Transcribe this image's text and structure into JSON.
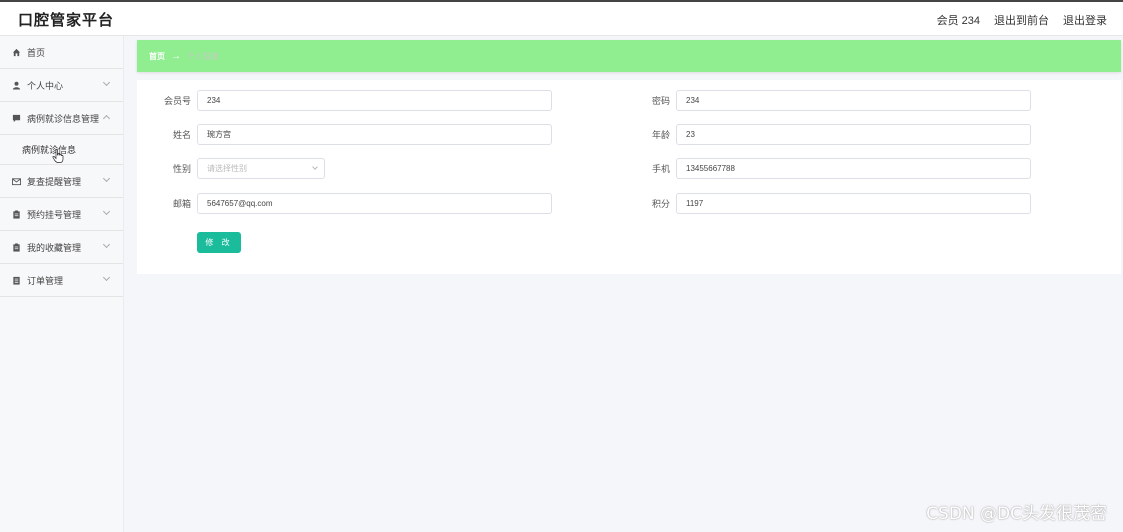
{
  "header": {
    "brand": "口腔管家平台",
    "member": "会员 234",
    "to_front": "退出到前台",
    "logout": "退出登录"
  },
  "sidebar": {
    "items": [
      {
        "label": "首页",
        "icon": "home-icon"
      },
      {
        "label": "个人中心",
        "icon": "user-icon"
      },
      {
        "label": "病例就诊信息管理",
        "icon": "chat-icon",
        "expanded": true,
        "children": [
          {
            "label": "病例就诊信息"
          }
        ]
      },
      {
        "label": "复查提醒管理",
        "icon": "mail-icon"
      },
      {
        "label": "预约挂号管理",
        "icon": "clipboard-icon"
      },
      {
        "label": "我的收藏管理",
        "icon": "clipboard-icon"
      },
      {
        "label": "订单管理",
        "icon": "list-icon"
      }
    ]
  },
  "breadcrumb": {
    "home": "首页",
    "arrow": "→",
    "current": "个人信息"
  },
  "form": {
    "member_no": {
      "label": "会员号",
      "value": "234"
    },
    "password": {
      "label": "密码",
      "value": "234"
    },
    "name": {
      "label": "姓名",
      "value": "琬方宫"
    },
    "age": {
      "label": "年龄",
      "value": "23"
    },
    "gender": {
      "label": "性别",
      "placeholder": "请选择性别"
    },
    "phone": {
      "label": "手机",
      "value": "13455667788"
    },
    "email": {
      "label": "邮箱",
      "value": "5647657@qq.com"
    },
    "points": {
      "label": "积分",
      "value": "1197"
    },
    "submit": "修 改"
  },
  "watermark": "CSDN @DC头发很茂密",
  "colors": {
    "accent": "#1abc9c",
    "breadcrumb_bg": "#90ee90"
  }
}
